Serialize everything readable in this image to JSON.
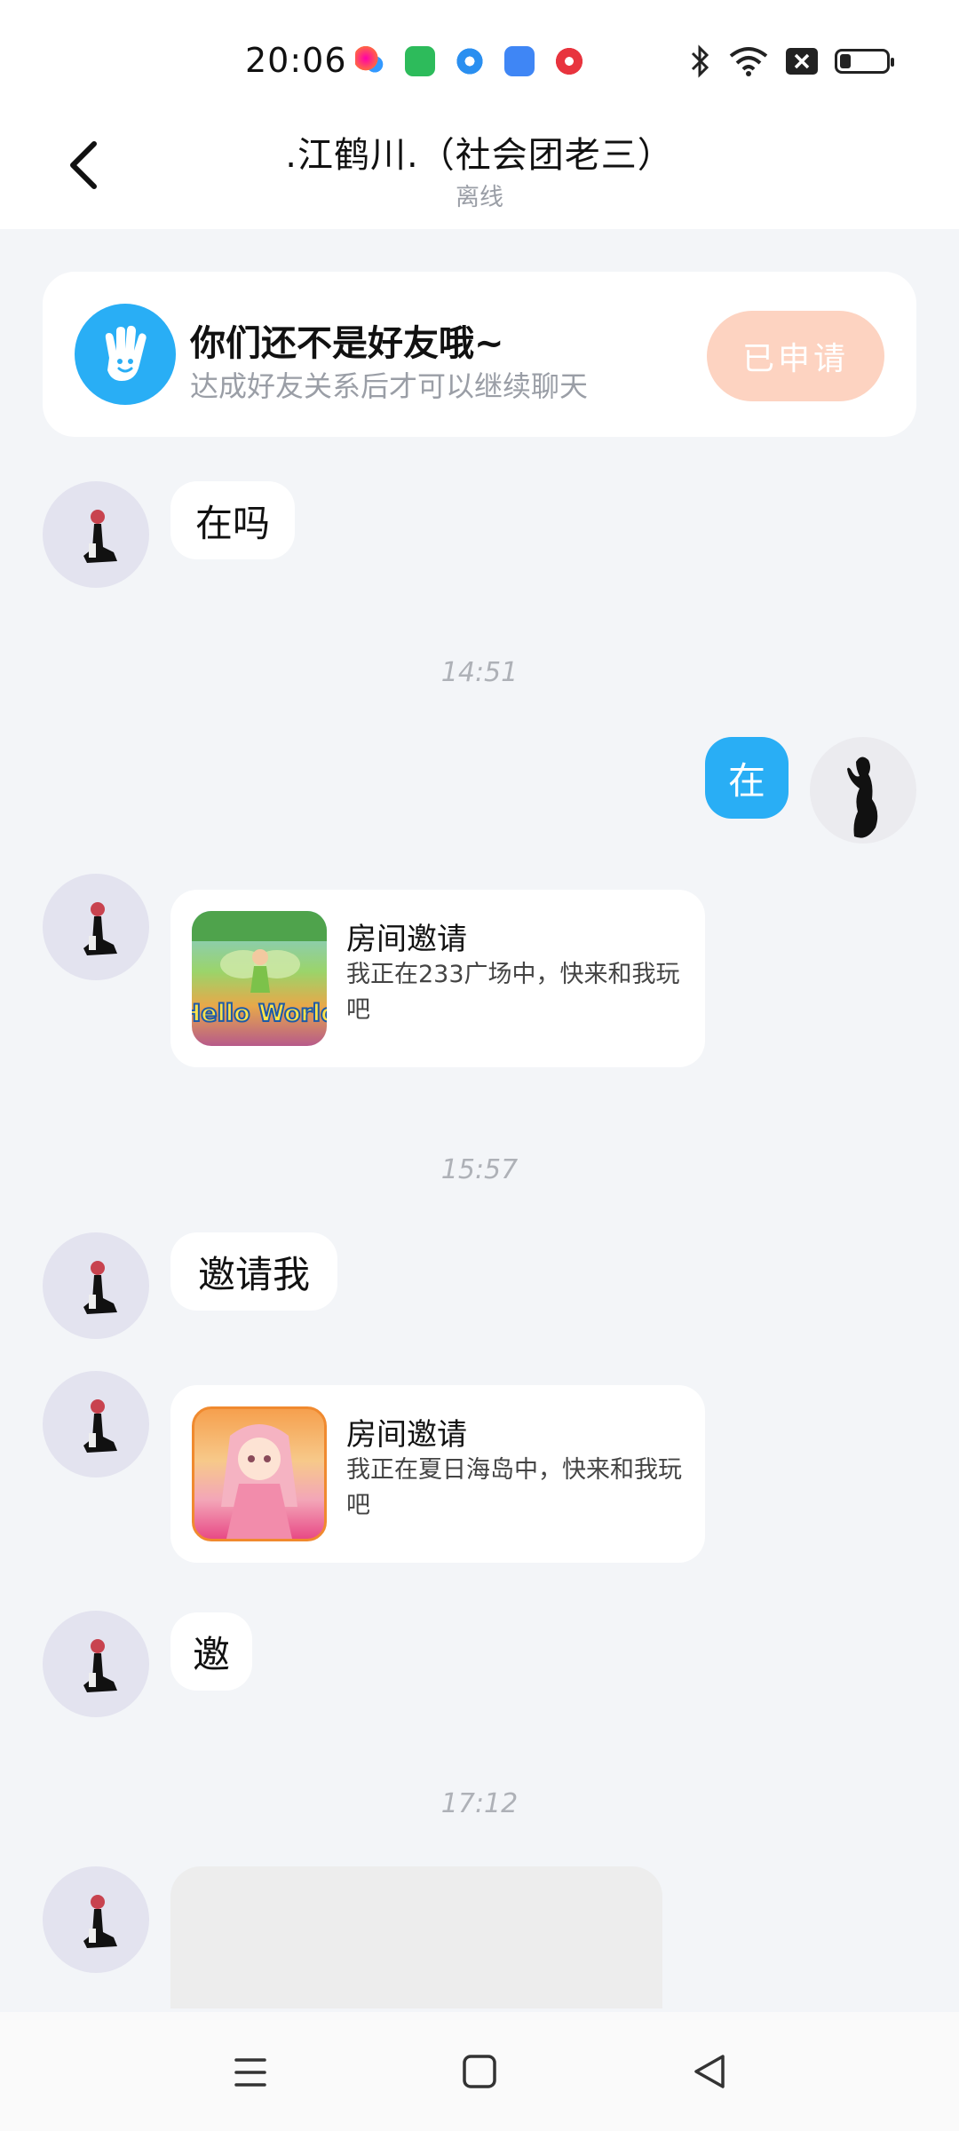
{
  "status_bar": {
    "time": "20:06",
    "app_icons": [
      {
        "name": "flower-app-icon",
        "color": "#e8566b"
      },
      {
        "name": "green-bag-app-icon",
        "color": "#2dbb5b"
      },
      {
        "name": "blue-ring-app-icon",
        "color": "#2a8ff0"
      },
      {
        "name": "cloud-app-icon",
        "color": "#3f86f5"
      },
      {
        "name": "red-play-app-icon",
        "color": "#e8343e"
      }
    ]
  },
  "header": {
    "title": ".江鹤川.（社会团老三）",
    "status": "离线"
  },
  "friend_notice": {
    "title": "你们还不是好友哦~",
    "subtitle": "达成好友关系后才可以继续聊天",
    "button": "已申请"
  },
  "messages": {
    "m1": "在吗",
    "ts1": "14:51",
    "m2": "在",
    "invite1": {
      "title": "房间邀请",
      "desc": "我正在233广场中，快来和我玩吧",
      "thumb_text": "Hello World"
    },
    "ts2": "15:57",
    "m3": "邀请我",
    "invite2": {
      "title": "房间邀请",
      "desc": "我正在夏日海岛中，快来和我玩吧"
    },
    "m4": "邀",
    "ts3": "17:12"
  },
  "colors": {
    "accent": "#29aef5",
    "applied_button": "#fdd3c1",
    "background": "#f3f5f8"
  }
}
